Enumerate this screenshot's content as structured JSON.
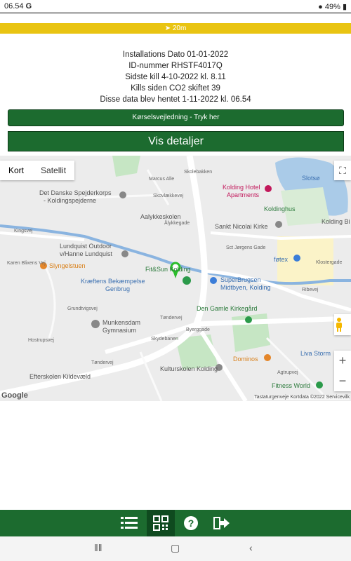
{
  "status_bar": {
    "time": "06.54",
    "carrier_icon": "G",
    "battery": "49%"
  },
  "distance_bar": {
    "text": "20m"
  },
  "info": {
    "line1": "Installations Dato 01-01-2022",
    "line2": "ID-nummer RHSTF4017Q",
    "line3": "Sidste kill 4-10-2022 kl. 8.11",
    "line4": "Kills siden CO2 skiftet 39",
    "line5": "Disse data blev hentet 1-11-2022 kl. 06.54"
  },
  "buttons": {
    "directions": "Kørselsvejledning - Tryk her",
    "details": "Vis detaljer"
  },
  "map": {
    "type_map": "Kort",
    "type_satellite": "Satellit",
    "attribution": "Tastaturgenveje   Kortdata ©2022   Servicevilk",
    "google": "Google",
    "labels": {
      "spejder1": "Det Danske Spejderkorps",
      "spejder2": "- Koldingspejderne",
      "aalykke": "Aalykkeskolen",
      "lundquist1": "Lundquist Outdoor",
      "lundquist2": "v/Hanne Lundquist",
      "slyngel": "Slyngelstuen",
      "fitsun": "Fit&Sun Kolding",
      "kraeftens1": "Kræftens Bekæmpelse",
      "kraeftens2": "Genbrug",
      "munkensdam1": "Munkensdam",
      "munkensdam2": "Gymnasium",
      "efterskolen": "Efterskolen Kildevæld",
      "koldinghotel1": "Kolding Hotel",
      "koldinghotel2": "Apartments",
      "koldinghus": "Koldinghus",
      "koldingbib": "Kolding Bi",
      "nicolai": "Sankt Nicolai Kirke",
      "fotex": "føtex",
      "superbrugsen1": "SuperBrugsen",
      "superbrugsen2": "Midtbyen, Kolding",
      "kirkegaard": "Den Gamle Kirkegård",
      "dominos": "Dominos",
      "livastorm": "Liva Storm",
      "kulturskolen": "Kulturskolen Kolding",
      "fitnessworld": "Fitness World",
      "slotsso": "Slotsø",
      "toendervej": "Tøndervej",
      "toendervej2": "Tøndervej",
      "kingsvej": "Kingsvej",
      "marcus": "Marcus Alle",
      "skovlaek": "Skovlækkevej",
      "aalykkegade": "Ålykkegade",
      "jorgens": "Sct Jørgens Gade",
      "klostergade": "Klostergade",
      "ribevej": "Ribevej",
      "byerggade": "Byerggade",
      "skydebanen": "Skydebanen",
      "hostrup": "Hostrupsvej",
      "grundtvig": "Grundtvigsvej",
      "karen": "Karen Blixens Vej",
      "skolebakken": "Skolebakken",
      "agtrupvej": "Agtrupvej"
    }
  },
  "colors": {
    "brand_green": "#1c6b2f",
    "accent_yellow": "#e9c412"
  }
}
